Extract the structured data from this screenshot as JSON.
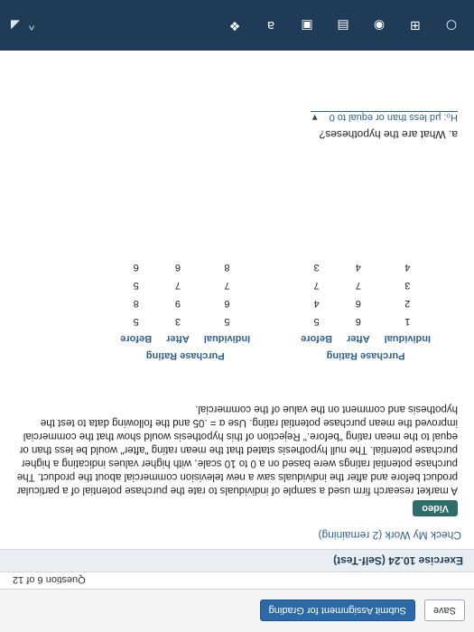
{
  "app": {
    "save_label": "Save",
    "submit_label": "Submit Assignment for Grading",
    "question_nav": "Question 6 of 12",
    "exercise_title": "Exercise 10.24 (Self-Test)",
    "check_my_work": "Check My Work (2 remaining)",
    "video_label": "Video"
  },
  "problem": {
    "text": "A market research firm used a sample of individuals to rate the purchase potential of a particular product before and after the individuals saw a new television commercial about the product. The purchase potential ratings were based on a 0 to 10 scale, with higher values indicating a higher purchase potential. The null hypothesis stated that the mean rating \"after\" would be less than or equal to the mean rating \"before.\" Rejection of this hypothesis would show that the commercial improved the mean purchase potential rating. Use α = .05 and the following data to test the hypothesis and comment on the value of the commercial."
  },
  "table_left": {
    "caption": "Purchase Rating",
    "headers": [
      "Individual",
      "After",
      "Before"
    ],
    "rows": [
      [
        "1",
        "6",
        "5"
      ],
      [
        "2",
        "6",
        "4"
      ],
      [
        "3",
        "7",
        "7"
      ],
      [
        "4",
        "4",
        "3"
      ]
    ]
  },
  "table_right": {
    "caption": "Purchase Rating",
    "headers": [
      "Individual",
      "After",
      "Before"
    ],
    "rows": [
      [
        "5",
        "3",
        "5"
      ],
      [
        "6",
        "9",
        "8"
      ],
      [
        "7",
        "7",
        "5"
      ],
      [
        "8",
        "6",
        "6"
      ]
    ]
  },
  "question_a": {
    "label": "a. What are the hypotheses?",
    "selected": "H₀: μd less than or equal to 0"
  }
}
